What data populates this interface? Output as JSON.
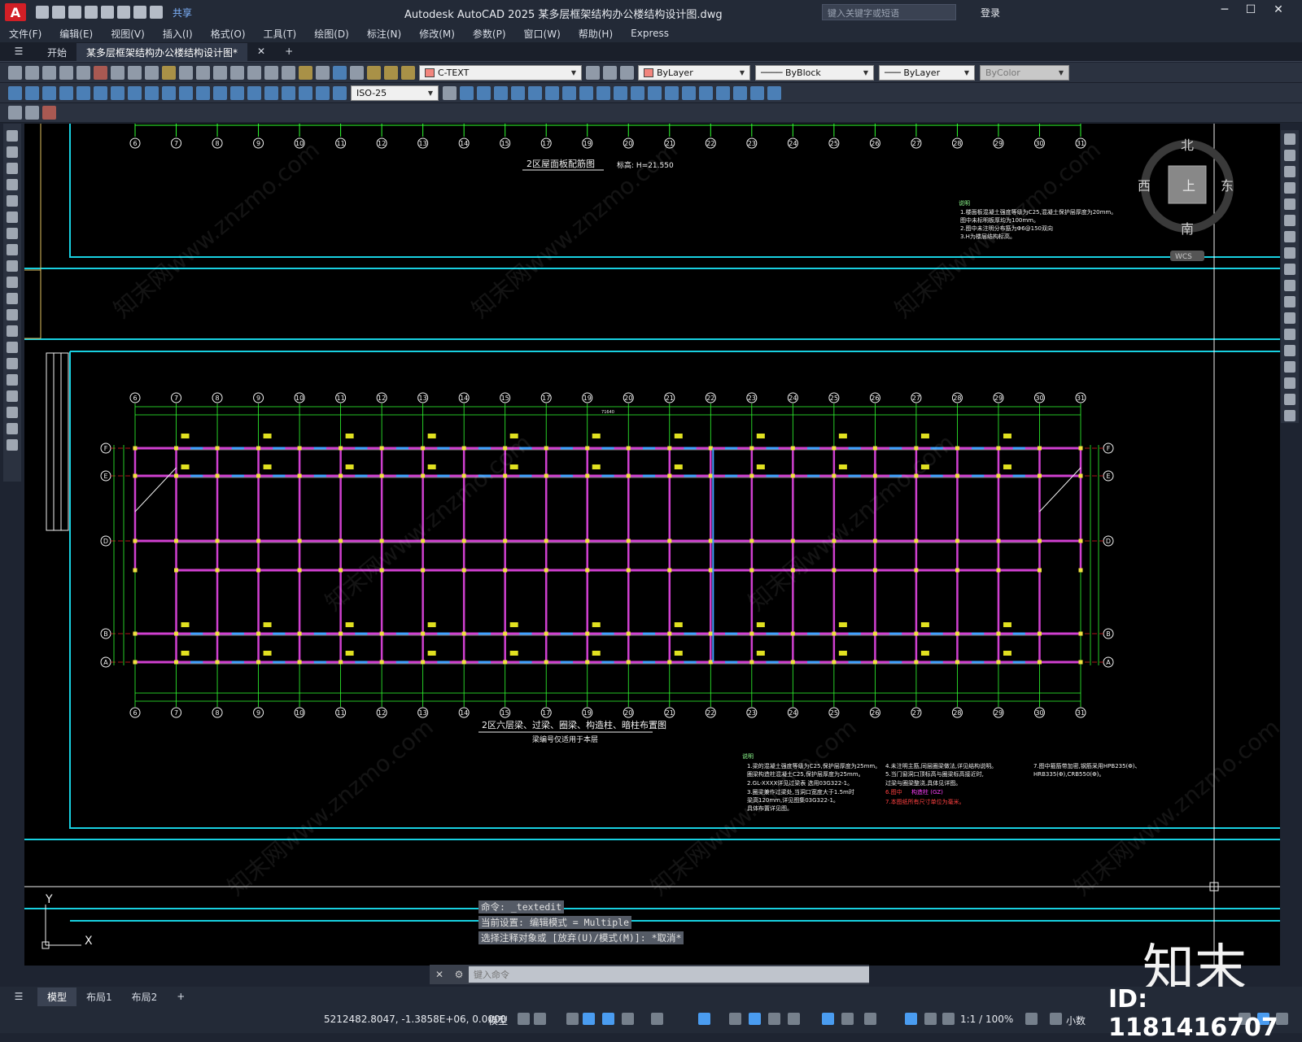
{
  "app": {
    "logo": "A",
    "title": "Autodesk AutoCAD 2025    某多层框架结构办公楼结构设计图.dwg",
    "share": "共享",
    "search_placeholder": "键入关键字或短语",
    "login": "登录"
  },
  "menu": [
    "文件(F)",
    "编辑(E)",
    "视图(V)",
    "插入(I)",
    "格式(O)",
    "工具(T)",
    "绘图(D)",
    "标注(N)",
    "修改(M)",
    "参数(P)",
    "窗口(W)",
    "帮助(H)",
    "Express"
  ],
  "tabs": {
    "start": "开始",
    "file": "某多层框架结构办公楼结构设计图*"
  },
  "props": {
    "layer": "C-TEXT",
    "color": "ByLayer",
    "linetype": "ByBlock",
    "lineweight": "ByLayer",
    "plotstyle": "ByColor",
    "dimstyle": "ISO-25"
  },
  "viewcube": {
    "north": "北",
    "south": "南",
    "east": "东",
    "west": "西",
    "top": "上",
    "wcs": "WCS"
  },
  "drawing": {
    "grid_labels": [
      "6",
      "7",
      "8",
      "9",
      "10",
      "11",
      "12",
      "13",
      "14",
      "15",
      "17",
      "19",
      "20",
      "21",
      "22",
      "23",
      "24",
      "25",
      "26",
      "27",
      "28",
      "29",
      "30",
      "31"
    ],
    "row_labels": [
      "F",
      "E",
      "D",
      "B",
      "A"
    ],
    "top_title": "2区屋面板配筋图",
    "top_subtitle": "标高: H=21.550",
    "main_title": "2区六层梁、过梁、圈梁、构造柱、暗柱布置图",
    "main_subtitle": "梁编号仅适用于本层",
    "total_dim": "71640",
    "notes_top": [
      "说明",
      "1.楼面板混凝土强度等级为C25,混凝土保护层厚度为20mm。",
      "  图中未标明板厚均为100mm。",
      "2.图中未注明分布筋为Φ6@150双向",
      "3.H为楼层结构标高。"
    ],
    "notes_bottom_title": "说明",
    "notes_bottom_col1": [
      "1.梁的混凝土强度等级为C25,保护层厚度为25mm。",
      "  圈梁构造柱混凝土C25,保护层厚度为25mm。",
      "2.GL-XXXX详见过梁表 选用03G322-1。",
      "3.圈梁兼作过梁处,当洞口宽度大于1.5m时",
      "  梁高120mm,详见图集03G322-1。",
      "  具体布置详见图。"
    ],
    "notes_bottom_col2": [
      "4.未注明主筋,同层圈梁做法,详见结构说明。",
      "5.当门窗洞口顶标高与圈梁标高接近时,",
      "  过梁与圈梁整浇,具体见详图。",
      "6.图中",
      "  构造柱 (GZ)",
      "7.本图纸所有尺寸单位为毫米。"
    ],
    "notes_bottom_col3": [
      "7.图中箍筋带加密,钢筋采用HPB235(Φ)、",
      "  HRB335(Φ),CRB550(Φ)。"
    ]
  },
  "command": {
    "history": [
      "命令: _textedit",
      "当前设置: 编辑模式 = Multiple",
      "选择注释对象或 [放弃(U)/模式(M)]: *取消*"
    ],
    "placeholder": "键入命令"
  },
  "layouts": [
    "模型",
    "布局1",
    "布局2"
  ],
  "status": {
    "coords": "5212482.8047, -1.3858E+06, 0.0000",
    "model": "模型",
    "scale": "1:1 / 100%",
    "units": "小数"
  },
  "watermark": {
    "logo": "知末",
    "id": "ID: 1181416707",
    "site": "知末网www.znzmo.com"
  },
  "ucs": {
    "x": "X",
    "y": "Y"
  }
}
